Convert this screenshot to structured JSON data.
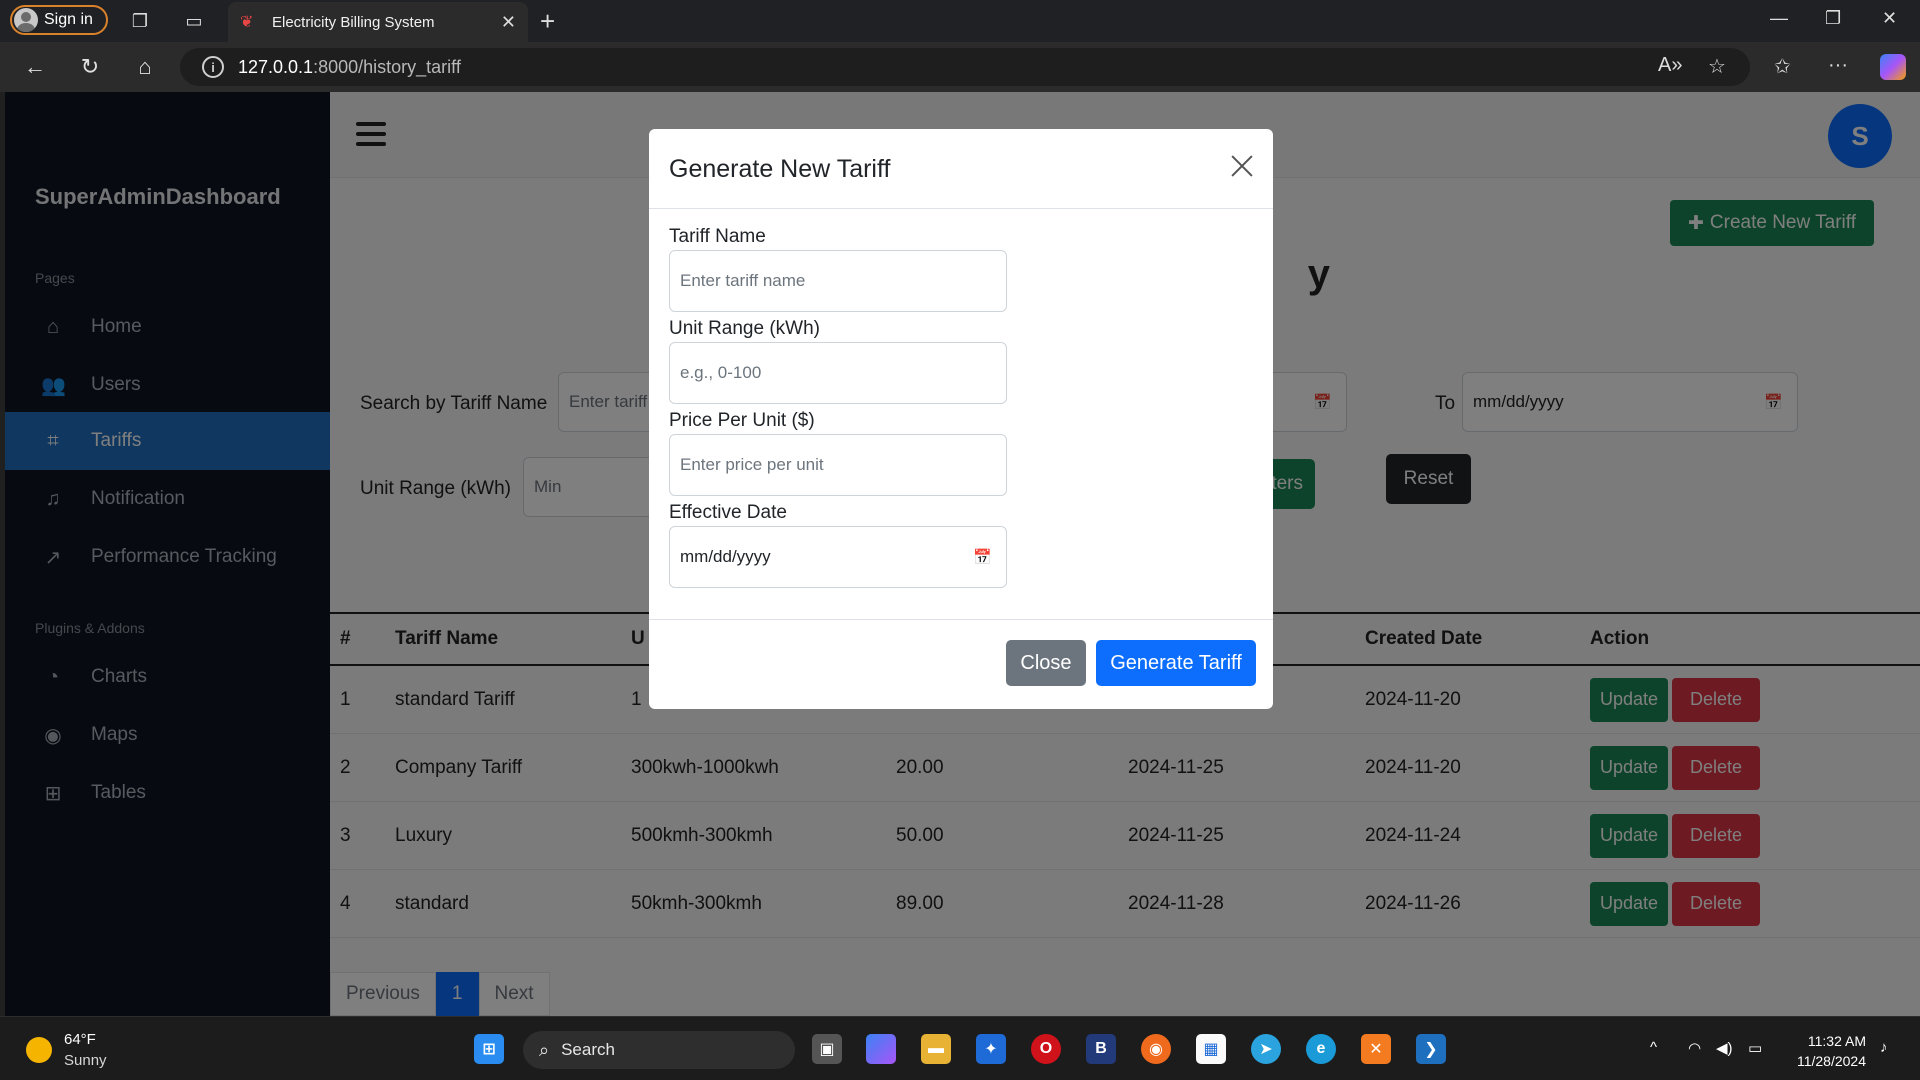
{
  "browser": {
    "signin_label": "Sign in",
    "tab_title": "Electricity Billing System",
    "url_host": "127.0.0.1",
    "url_path": ":8000/history_tariff"
  },
  "sidebar": {
    "brand": "SuperAdminDashboard",
    "section_pages": "Pages",
    "section_plugins": "Plugins & Addons",
    "items": [
      {
        "label": "Home",
        "icon": "home-icon"
      },
      {
        "label": "Users",
        "icon": "users-icon"
      },
      {
        "label": "Tariffs",
        "icon": "tag-icon"
      },
      {
        "label": "Notification",
        "icon": "bell-icon"
      },
      {
        "label": "Performance Tracking",
        "icon": "trend-icon"
      },
      {
        "label": "Charts",
        "icon": "pie-chart-icon"
      },
      {
        "label": "Maps",
        "icon": "map-pin-icon"
      },
      {
        "label": "Tables",
        "icon": "grid-icon"
      }
    ]
  },
  "header": {
    "avatar_initial": "S",
    "create_button": "Create New Tariff",
    "heading_fragment": "y"
  },
  "filters": {
    "search_label": "Search by Tariff Name",
    "search_placeholder": "Enter tariff",
    "to_label": "To",
    "date_placeholder": "mm/dd/yyyy",
    "unit_range_label": "Unit Range (kWh)",
    "min_placeholder": "Min",
    "apply_label": "y Filters",
    "reset_label": "Reset"
  },
  "table": {
    "headers": [
      "#",
      "Tariff Name",
      "U",
      "",
      "",
      "Created Date",
      "Action"
    ],
    "rows": [
      {
        "num": "1",
        "name": "standard Tariff",
        "range": "1",
        "price": "",
        "eff": "",
        "created": "2024-11-20"
      },
      {
        "num": "2",
        "name": "Company Tariff",
        "range": "300kwh-1000kwh",
        "price": "20.00",
        "eff": "2024-11-25",
        "created": "2024-11-20"
      },
      {
        "num": "3",
        "name": "Luxury",
        "range": "500kmh-300kmh",
        "price": "50.00",
        "eff": "2024-11-25",
        "created": "2024-11-24"
      },
      {
        "num": "4",
        "name": "standard",
        "range": "50kmh-300kmh",
        "price": "89.00",
        "eff": "2024-11-28",
        "created": "2024-11-26"
      }
    ],
    "update_label": "Update",
    "delete_label": "Delete"
  },
  "pagination": {
    "prev": "Previous",
    "current": "1",
    "next": "Next"
  },
  "modal": {
    "title": "Generate New Tariff",
    "name_label": "Tariff Name",
    "name_placeholder": "Enter tariff name",
    "range_label": "Unit Range (kWh)",
    "range_placeholder": "e.g., 0-100",
    "price_label": "Price Per Unit ($)",
    "price_placeholder": "Enter price per unit",
    "date_label": "Effective Date",
    "date_value": "mm/dd/yyyy",
    "close_label": "Close",
    "submit_label": "Generate Tariff"
  },
  "taskbar": {
    "temp": "64°F",
    "condition": "Sunny",
    "search_label": "Search",
    "time": "11:32 AM",
    "date": "11/28/2024"
  },
  "colors": {
    "primary": "#0d6efd",
    "success": "#198754",
    "danger": "#dc3545",
    "secondary": "#6c757d",
    "sidebar_bg": "#0f1520"
  }
}
